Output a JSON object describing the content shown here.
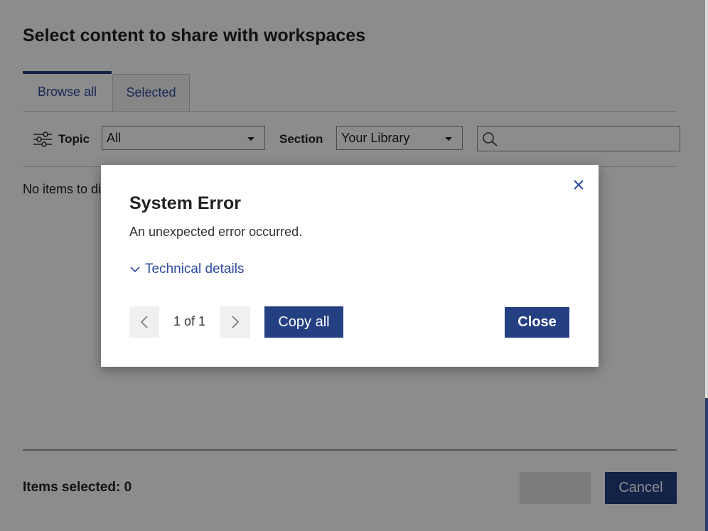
{
  "dialog": {
    "title": "Select content to share with workspaces",
    "tabs": [
      {
        "label": "Browse all",
        "active": true
      },
      {
        "label": "Selected",
        "active": false
      }
    ],
    "filters": {
      "topic_label": "Topic",
      "topic_value": "All",
      "section_label": "Section",
      "section_value": "Your Library",
      "search_value": ""
    },
    "empty_message": "No items to display",
    "items_selected": "Items selected: 0",
    "cancel_label": "Cancel"
  },
  "error_modal": {
    "title": "System Error",
    "message": "An unexpected error occurred.",
    "details_label": "Technical details",
    "pager_text": "1 of 1",
    "copy_label": "Copy all",
    "close_label": "Close"
  },
  "colors": {
    "accent": "#243f82",
    "link": "#2c4a9a",
    "overlay": "rgba(0,0,0,0.45)"
  }
}
